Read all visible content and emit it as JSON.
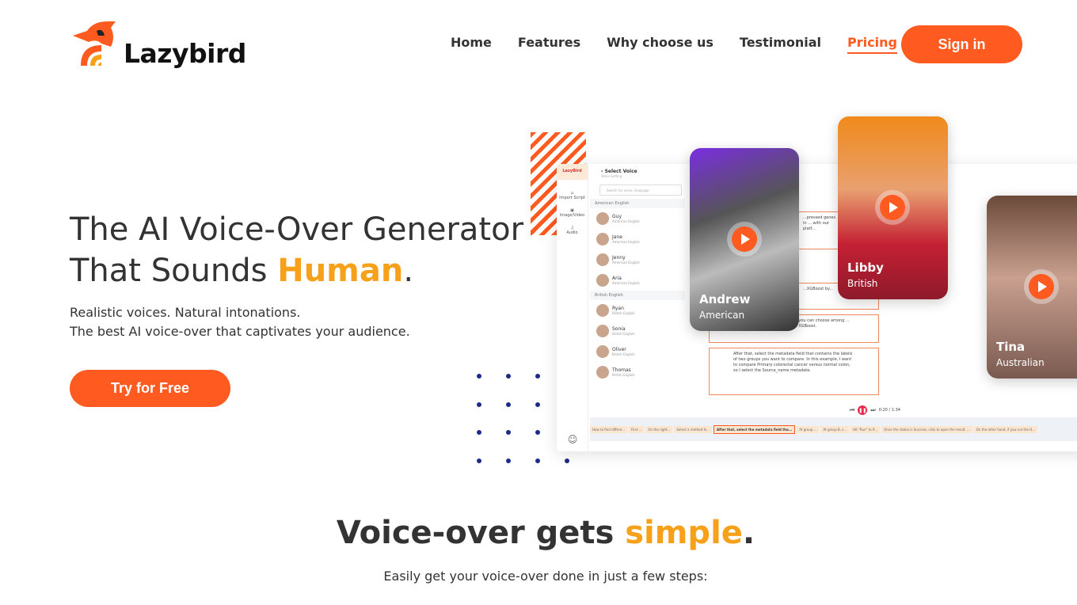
{
  "brand": {
    "name": "Lazybird",
    "accent": "#ff5a1f",
    "highlight": "#f7a11a"
  },
  "nav": {
    "items": [
      {
        "label": "Home"
      },
      {
        "label": "Features"
      },
      {
        "label": "Why choose us"
      },
      {
        "label": "Testimonial"
      },
      {
        "label": "Pricing",
        "active": true
      }
    ],
    "signin": "Sign in"
  },
  "hero": {
    "title_line1": "The AI Voice-Over Generator",
    "title_line2_pre": "That Sounds ",
    "title_highlight": "Human",
    "title_end": ".",
    "sub1": "Realistic voices. Natural intonations.",
    "sub2": "The best AI voice-over that captivates your audience.",
    "cta": "Try for Free"
  },
  "mockup": {
    "brand": "LazyBird",
    "rail": [
      {
        "label": "Import Script",
        "icon": "home-icon"
      },
      {
        "label": "Image/Video",
        "icon": "image-icon"
      },
      {
        "label": "Audio",
        "icon": "music-icon"
      }
    ],
    "panel_title": "Select Voice",
    "panel_sub": "Voice Setting",
    "search_placeholder": "Search for voice, language",
    "groups": [
      {
        "name": "American English",
        "voices": [
          {
            "name": "Guy",
            "lang": "American English"
          },
          {
            "name": "Jane",
            "lang": "American English"
          },
          {
            "name": "Jenny",
            "lang": "American English"
          },
          {
            "name": "Aria",
            "lang": "American English"
          }
        ]
      },
      {
        "name": "British English",
        "voices": [
          {
            "name": "Ryan",
            "lang": "British English"
          },
          {
            "name": "Sonia",
            "lang": "British English"
          },
          {
            "name": "Oliver",
            "lang": "British English"
          },
          {
            "name": "Thomas",
            "lang": "British English"
          }
        ]
      }
    ],
    "script_lines": [
      "...pressed genes in ... with our platf...",
      "...XGBoost by...",
      "...lysis. Here you can choose among ... DESeq2 and XGBoost.",
      "After that, select the metadata field that contains the labels of two groups you want to compare. In this example, I want to compare Primary colorectal cancer versus normal colon, so I select the Source_name metadata."
    ],
    "player_time": "0:20 / 1:34",
    "timeline": [
      "How to find differe...",
      "First ...",
      "On the right...",
      "Select a method fo...",
      "After that, select the metadata field tha...",
      "At group ...",
      "At group B, s...",
      "Hit \"Run\" to fi...",
      "Once the status is Success, click to open the result. ...",
      "On the other hand, if you run the D..."
    ],
    "cards": [
      {
        "name": "Andrew",
        "accent": "American"
      },
      {
        "name": "Libby",
        "accent": "British"
      },
      {
        "name": "Tina",
        "accent": "Australian"
      }
    ]
  },
  "section2": {
    "title_pre": "Voice-over gets ",
    "title_highlight": "simple",
    "title_end": ".",
    "sub": "Easily get your voice-over done in just a few steps:"
  }
}
